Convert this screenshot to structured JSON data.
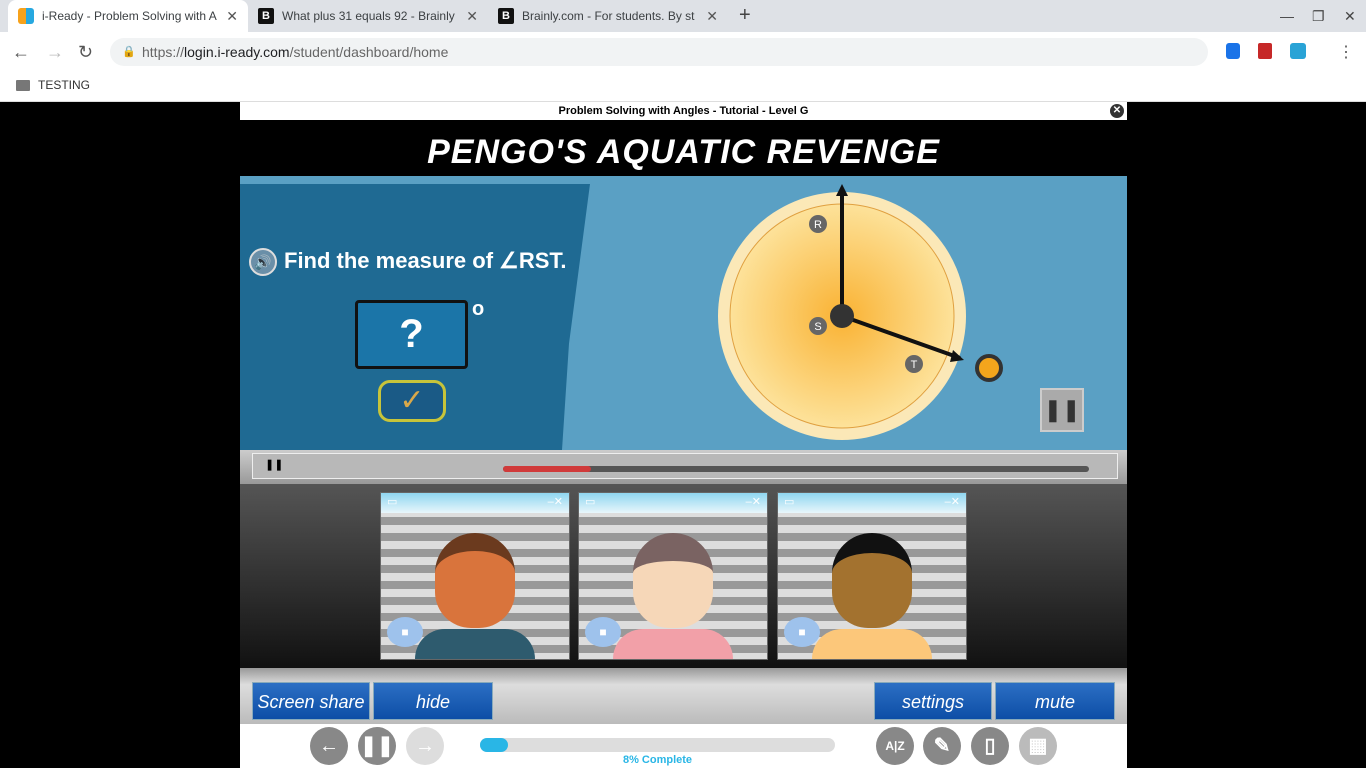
{
  "browser": {
    "tabs": [
      {
        "title": "i-Ready - Problem Solving with A",
        "active": true
      },
      {
        "title": "What plus 31 equals 92 - Brainly",
        "active": false
      },
      {
        "title": "Brainly.com - For students. By st",
        "active": false
      }
    ],
    "url_prefix": "https://",
    "url_host": "login.i-ready.com",
    "url_path": "/student/dashboard/home",
    "bookmark": "TESTING"
  },
  "lesson": {
    "header": "Problem Solving with Angles - Tutorial - Level G",
    "title": "PENGO'S AQUATIC REVENGE",
    "question": "Find the measure of ∠RST.",
    "answer_placeholder": "?",
    "degree": "o",
    "labels": {
      "r": "R",
      "s": "S",
      "t": "T"
    },
    "video_progress": 0.15,
    "buttons": {
      "screen_share": "Screen share",
      "hide": "hide",
      "settings": "settings",
      "mute": "mute"
    },
    "progress_percent": 8,
    "progress_label": "8% Complete"
  }
}
